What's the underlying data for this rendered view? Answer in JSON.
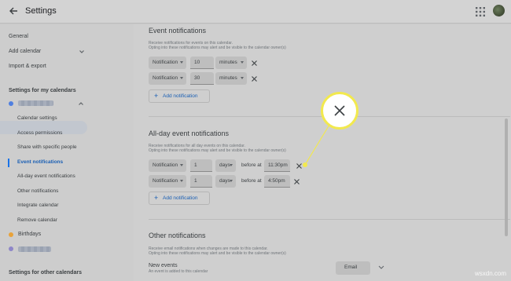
{
  "topbar": {
    "title": "Settings"
  },
  "sidebar": {
    "general": "General",
    "add_calendar": "Add calendar",
    "import_export": "Import & export",
    "my_calendars_header": "Settings for my calendars",
    "sub_items": [
      "Calendar settings",
      "Access permissions",
      "Share with specific people",
      "Event notifications",
      "All-day event notifications",
      "Other notifications",
      "Integrate calendar",
      "Remove calendar"
    ],
    "birthdays": "Birthdays",
    "other_calendars_header": "Settings for other calendars",
    "colors": {
      "primary_dot": "#4f7fe0",
      "birthdays_dot": "#e8a23a",
      "third_dot": "#8e86c8",
      "active": "#1a73e8"
    }
  },
  "event_notifications": {
    "title": "Event notifications",
    "desc_line1": "Receive notifications for events on this calendar.",
    "desc_line2": "Opting into these notifications may alert and be visible to the calendar owner(s)",
    "rows": [
      {
        "type": "Notification",
        "amount": "10",
        "unit": "minutes"
      },
      {
        "type": "Notification",
        "amount": "30",
        "unit": "minutes"
      }
    ],
    "add_label": "Add notification"
  },
  "allday_notifications": {
    "title": "All-day event notifications",
    "desc_line1": "Receive notifications for all day events on this calendar.",
    "desc_line2": "Opting into these notifications may alert and be visible to the calendar owner(s)",
    "rows": [
      {
        "type": "Notification",
        "amount": "1",
        "unit": "days",
        "before": "before at",
        "time": "11:30pm"
      },
      {
        "type": "Notification",
        "amount": "1",
        "unit": "days",
        "before": "before at",
        "time": "4:50pm"
      }
    ],
    "add_label": "Add notification"
  },
  "other_notifications": {
    "title": "Other notifications",
    "desc_line1": "Receive email notifications when changes are made to this calendar.",
    "desc_line2": "Opting into these notifications may alert and be visible to the calendar owner(s)",
    "new_events_label": "New events",
    "new_events_desc": "An event is added to this calendar",
    "email_option": "Email"
  },
  "callout": {
    "icon": "close-icon",
    "color": "#f2e94e"
  },
  "watermark": "wsxdn.com"
}
